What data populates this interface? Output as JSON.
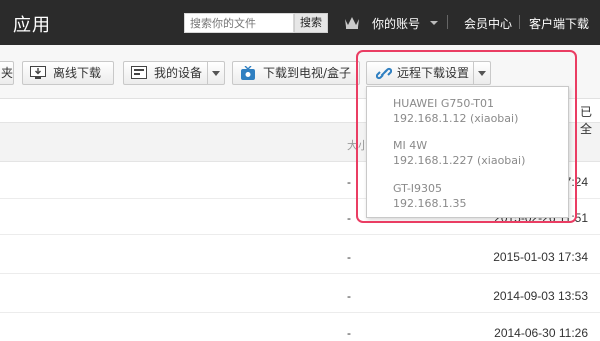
{
  "header": {
    "app_title": "应用",
    "search": {
      "placeholder": "搜索你的文件",
      "button_label": "搜索"
    },
    "account_label": "你的账号",
    "vip_label": "会员中心",
    "client_label": "客户端下载"
  },
  "toolbar": {
    "partial_left_label": "夹",
    "offline_download": "离线下载",
    "my_devices": "我的设备",
    "download_to_tv": "下载到电视/盒子",
    "remote_download_settings": "远程下载设置"
  },
  "list": {
    "size_header": "大小",
    "right_partial": "已全",
    "rows": [
      {
        "size": "-",
        "date": "2015-02-26 17:24"
      },
      {
        "size": "-",
        "date": "2015-02-26 11:51"
      },
      {
        "size": "-",
        "date": "2015-01-03 17:34"
      },
      {
        "size": "-",
        "date": "2014-09-03 13:53"
      },
      {
        "size": "-",
        "date": "2014-06-30 11:26"
      }
    ]
  },
  "remote_devices": [
    {
      "name": "HUAWEI G750-T01",
      "address": "192.168.1.12 (xiaobai)"
    },
    {
      "name": "MI 4W",
      "address": "192.168.1.227 (xiaobai)"
    },
    {
      "name": "GT-I9305",
      "address": "192.168.1.35"
    }
  ],
  "colors": {
    "topbar": "#2b2b2b",
    "highlight": "#ea3d63",
    "icon_blue": "#2f7fc1"
  }
}
